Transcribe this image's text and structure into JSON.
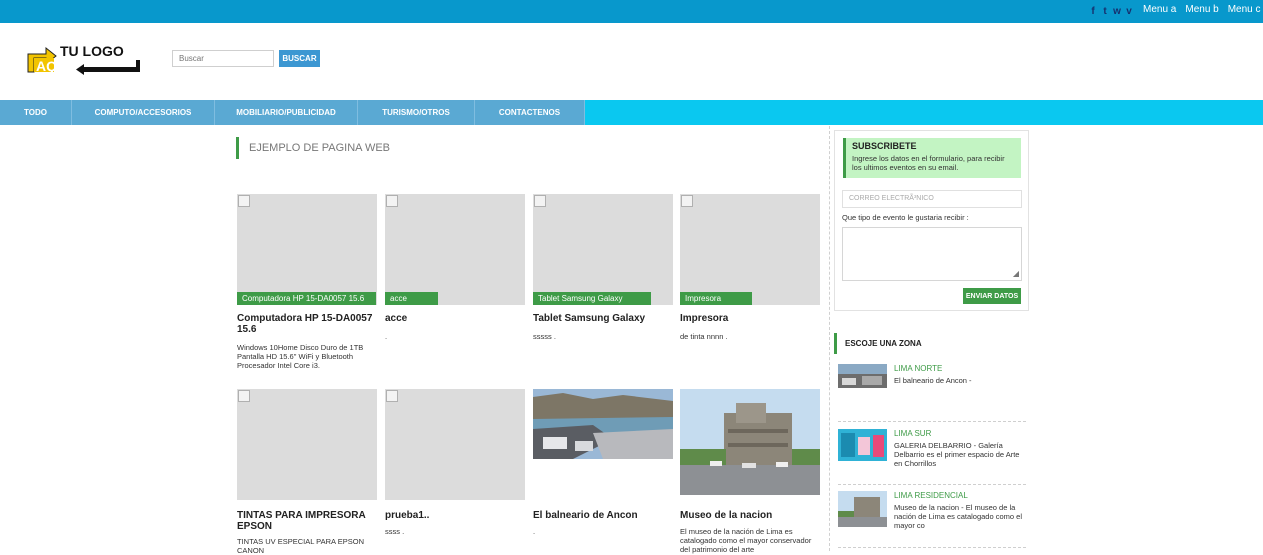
{
  "topbar": {
    "social": [
      {
        "icon": "facebook-icon",
        "glyph": "f"
      },
      {
        "icon": "twitter-icon",
        "glyph": "t"
      },
      {
        "icon": "whatsapp-icon",
        "glyph": "w"
      },
      {
        "icon": "vimeo-icon",
        "glyph": "v"
      }
    ],
    "menu": [
      "Menu a",
      "Menu b",
      "Menu c"
    ]
  },
  "header": {
    "logo_line1": "TU LOGO",
    "logo_line2": "AQUI",
    "search_placeholder": "Buscar",
    "search_button": "BUSCAR"
  },
  "nav": [
    "TODO",
    "COMPUTO/ACCESORIOS",
    "MOBILIARIO/PUBLICIDAD",
    "TURISMO/OTROS",
    "CONTACTENOS"
  ],
  "main": {
    "section_title": "EJEMPLO DE PAGINA WEB",
    "products": [
      {
        "tag": "Computadora HP 15-DA0057 15.6",
        "title": "Computadora HP 15-DA0057 15.6",
        "desc": "Windows 10Home Disco Duro de 1TB Pantalla HD 15.6\" WiFi y Bluetooth Procesador Intel Core i3."
      },
      {
        "tag": "acce",
        "title": "acce",
        "desc": "."
      },
      {
        "tag": "Tablet Samsung Galaxy",
        "title": "Tablet Samsung Galaxy",
        "desc": "sssss ."
      },
      {
        "tag": "Impresora",
        "title": "Impresora",
        "desc": "de tinta nnnn ."
      },
      {
        "tag": "",
        "title": "TINTAS PARA IMPRESORA EPSON",
        "desc": "TINTAS UV ESPECIAL PARA EPSON CANON"
      },
      {
        "tag": "",
        "title": "prueba1..",
        "desc": "ssss ."
      },
      {
        "tag": "",
        "title": "El balneario de Ancon",
        "desc": "."
      },
      {
        "tag": "",
        "title": "Museo de la nacion",
        "desc": "El museo de la nación de Lima es catalogado como el mayor conservador del patrimonio del arte"
      }
    ]
  },
  "sidebar": {
    "subscribe": {
      "title": "SUBSCRIBETE",
      "text": "Ingrese los datos en el formulario, para recibir los ultimos eventos en su email.",
      "email_placeholder": "CORREO ELECTRÃ³NICO",
      "event_label": "Que tipo de evento le gustaria recibir :",
      "send_button": "ENVIAR DATOS"
    },
    "zones_title": "ESCOJE UNA ZONA",
    "zones": [
      {
        "name": "LIMA NORTE",
        "desc": "El balneario de Ancon -"
      },
      {
        "name": "LIMA SUR",
        "desc": "GALERIA DELBARRIO - Galería Delbarrio es el primer espacio de Arte en Chorrillos"
      },
      {
        "name": "LIMA RESIDENCIAL",
        "desc": "Museo de la nacion - El museo de la nación de Lima es catalogado como el mayor co"
      }
    ]
  },
  "colors": {
    "topbar": "#0898cc",
    "nav": "#0ac8f0",
    "nav_inner": "#5aa9d3",
    "accent_green": "#3e9b47",
    "subscribe_bg": "#c3f4c3",
    "button_blue": "#3c97d2"
  }
}
